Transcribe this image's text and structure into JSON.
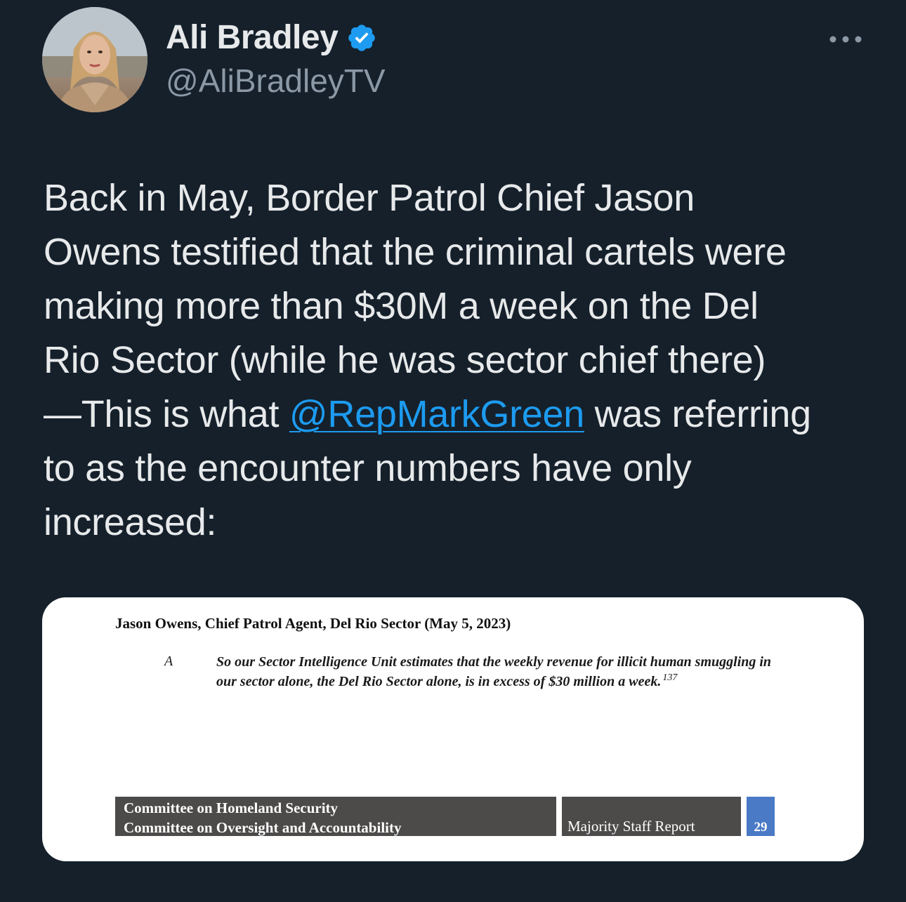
{
  "author": {
    "display_name": "Ali Bradley",
    "handle": "@AliBradleyTV",
    "verified_icon": "verified-badge-icon",
    "verified_color": "#1d9bf0"
  },
  "more_icon": "more-options-icon",
  "tweet": {
    "text_before": "Back in May, Border Patrol Chief Jason\nOwens testified that the criminal cartels were\nmaking more than $30M a week on the Del\nRio Sector (while he was sector chief there)\n—This is what ",
    "mention": "@RepMarkGreen",
    "text_after": " was referring\nto as the encounter numbers have only\nincreased:"
  },
  "media": {
    "heading": "Jason Owens, Chief Patrol Agent, Del Rio Sector (May 5, 2023)",
    "answer_label": "A",
    "quote": "So our Sector Intelligence Unit estimates that the weekly revenue for illicit human smuggling in our sector alone, the Del Rio Sector alone, is in excess of $30 million a week.",
    "footnote": "137",
    "footer_line1": "Committee on Homeland Security",
    "footer_line2": "Committee on Oversight and Accountability",
    "footer_report": "Majority Staff Report",
    "page_number": "29"
  },
  "colors": {
    "background": "#15202b",
    "text": "#e7e9ea",
    "secondary_text": "#8b98a5",
    "link": "#1d9bf0"
  }
}
